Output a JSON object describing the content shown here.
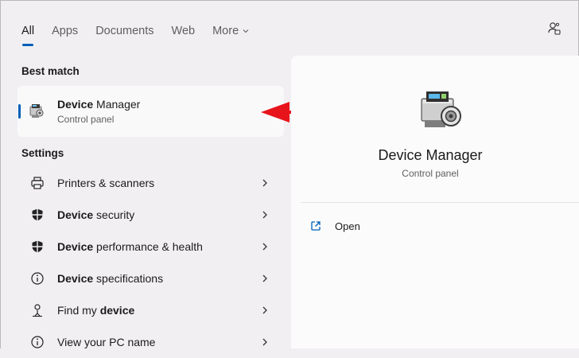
{
  "tabs": [
    {
      "label": "All",
      "active": true
    },
    {
      "label": "Apps"
    },
    {
      "label": "Documents"
    },
    {
      "label": "Web"
    },
    {
      "label": "More"
    }
  ],
  "best_match": {
    "section_label": "Best match",
    "title_bold": "Device",
    "title_rest": " Manager",
    "subtitle": "Control panel"
  },
  "settings": {
    "section_label": "Settings",
    "items": [
      {
        "pre": "",
        "bold": "",
        "post": "Printers & scanners",
        "icon": "printer-icon"
      },
      {
        "pre": "",
        "bold": "Device",
        "post": " security",
        "icon": "shield-icon"
      },
      {
        "pre": "",
        "bold": "Device",
        "post": " performance & health",
        "icon": "shield-icon"
      },
      {
        "pre": "",
        "bold": "Device",
        "post": " specifications",
        "icon": "info-icon"
      },
      {
        "pre": "Find my ",
        "bold": "device",
        "post": "",
        "icon": "person-location-icon"
      },
      {
        "pre": "View your PC name",
        "bold": "",
        "post": "",
        "icon": "info-icon"
      }
    ]
  },
  "detail": {
    "title": "Device Manager",
    "subtitle": "Control panel",
    "actions": [
      {
        "label": "Open",
        "icon": "open-external-icon"
      }
    ]
  },
  "colors": {
    "accent": "#005fb8",
    "arrow": "#e8141b",
    "background": "#f1eff2",
    "pane": "#fbfbfc"
  }
}
